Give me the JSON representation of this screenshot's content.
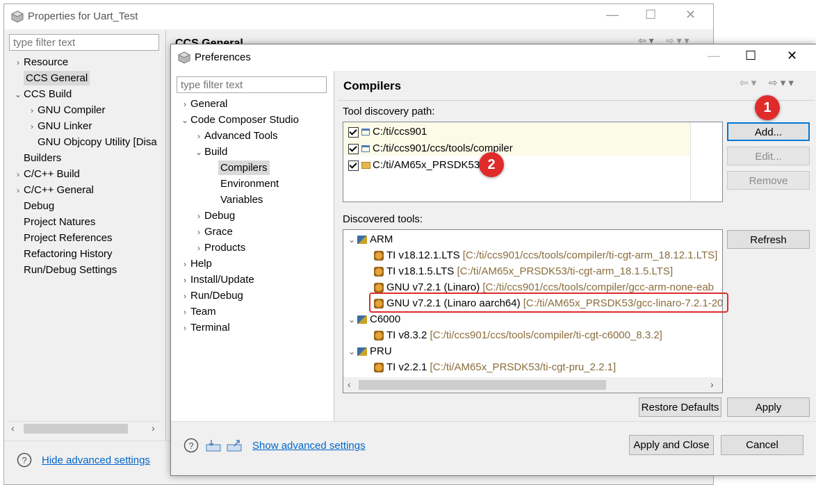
{
  "outer": {
    "title": "Properties for Uart_Test",
    "filter_placeholder": "type filter text",
    "header_fragment": "CCS General",
    "tree": [
      {
        "label": "Resource",
        "chev": "›"
      },
      {
        "label": "CCS General",
        "chev": ""
      },
      {
        "label": "CCS Build",
        "chev": "⌄"
      },
      {
        "label": "GNU Compiler",
        "chev": "›"
      },
      {
        "label": "GNU Linker",
        "chev": "›"
      },
      {
        "label": "GNU Objcopy Utility  [Disa",
        "chev": ""
      },
      {
        "label": "Builders",
        "chev": ""
      },
      {
        "label": "C/C++ Build",
        "chev": "›"
      },
      {
        "label": "C/C++ General",
        "chev": "›"
      },
      {
        "label": "Debug",
        "chev": ""
      },
      {
        "label": "Project Natures",
        "chev": ""
      },
      {
        "label": "Project References",
        "chev": ""
      },
      {
        "label": "Refactoring History",
        "chev": ""
      },
      {
        "label": "Run/Debug Settings",
        "chev": ""
      }
    ],
    "hide_link": "Hide advanced settings"
  },
  "dialog": {
    "title": "Preferences",
    "filter_placeholder": "type filter text",
    "tree": [
      {
        "label": "General",
        "chev": "›"
      },
      {
        "label": "Code Composer Studio",
        "chev": "⌄"
      },
      {
        "label": "Advanced Tools",
        "chev": "›"
      },
      {
        "label": "Build",
        "chev": "⌄"
      },
      {
        "label": "Compilers",
        "chev": ""
      },
      {
        "label": "Environment",
        "chev": ""
      },
      {
        "label": "Variables",
        "chev": ""
      },
      {
        "label": "Debug",
        "chev": "›"
      },
      {
        "label": "Grace",
        "chev": "›"
      },
      {
        "label": "Products",
        "chev": "›"
      },
      {
        "label": "Help",
        "chev": "›"
      },
      {
        "label": "Install/Update",
        "chev": "›"
      },
      {
        "label": "Run/Debug",
        "chev": "›"
      },
      {
        "label": "Team",
        "chev": "›"
      },
      {
        "label": "Terminal",
        "chev": "›"
      }
    ],
    "page_title": "Compilers",
    "discovery_label": "Tool discovery path:",
    "discovery_paths": [
      "C:/ti/ccs901",
      "C:/ti/ccs901/ccs/tools/compiler",
      "C:/ti/AM65x_PRSDK53"
    ],
    "buttons": {
      "add": "Add...",
      "edit": "Edit...",
      "remove": "Remove",
      "refresh": "Refresh",
      "restore": "Restore Defaults",
      "apply": "Apply",
      "apply_close": "Apply and Close",
      "cancel": "Cancel"
    },
    "discovered_label": "Discovered tools:",
    "groups": [
      {
        "name": "ARM",
        "tools": [
          {
            "name": "TI v18.12.1.LTS",
            "path": "[C:/ti/ccs901/ccs/tools/compiler/ti-cgt-arm_18.12.1.LTS]"
          },
          {
            "name": "TI v18.1.5.LTS",
            "path": "[C:/ti/AM65x_PRSDK53/ti-cgt-arm_18.1.5.LTS]"
          },
          {
            "name": "GNU v7.2.1 (Linaro)",
            "path": "[C:/ti/ccs901/ccs/tools/compiler/gcc-arm-none-eab"
          },
          {
            "name": "GNU v7.2.1 (Linaro aarch64)",
            "path": "[C:/ti/AM65x_PRSDK53/gcc-linaro-7.2.1-201"
          }
        ]
      },
      {
        "name": "C6000",
        "tools": [
          {
            "name": "TI v8.3.2",
            "path": "[C:/ti/ccs901/ccs/tools/compiler/ti-cgt-c6000_8.3.2]"
          }
        ]
      },
      {
        "name": "PRU",
        "tools": [
          {
            "name": "TI v2.2.1",
            "path": "[C:/ti/AM65x_PRSDK53/ti-cgt-pru_2.2.1]"
          }
        ]
      }
    ],
    "show_link": "Show advanced settings",
    "badges": [
      "1",
      "2"
    ]
  }
}
